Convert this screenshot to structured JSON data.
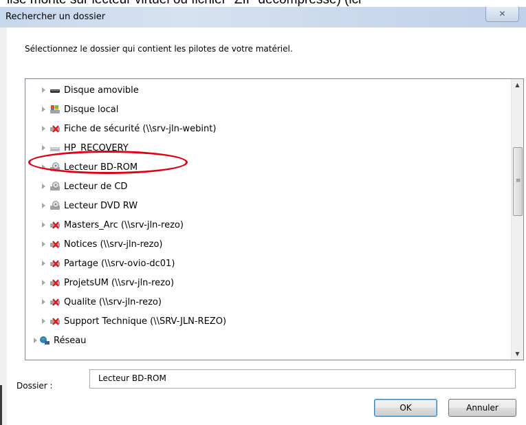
{
  "background_text": "lise monte sur lecteur virtuel ou fichier \"ZIP décompressé) (ici",
  "dialog": {
    "title": "Rechercher un dossier",
    "close_glyph": "✕",
    "instruction": "Sélectionnez le dossier qui contient les pilotes de votre matériel.",
    "tree": {
      "items": [
        {
          "label": "Disque amovible",
          "icon": "removable-drive-icon"
        },
        {
          "label": "Disque local",
          "icon": "local-disk-icon"
        },
        {
          "label": "Fiche de sécurité (\\\\srv-jln-webint)",
          "icon": "disconnected-network-drive-icon"
        },
        {
          "label": "HP_RECOVERY",
          "icon": "hard-drive-icon"
        },
        {
          "label": "Lecteur BD-ROM",
          "icon": "optical-drive-icon"
        },
        {
          "label": "Lecteur de CD",
          "icon": "optical-drive-icon"
        },
        {
          "label": "Lecteur DVD RW",
          "icon": "optical-drive-icon"
        },
        {
          "label": "Masters_Arc (\\\\srv-jln-rezo)",
          "icon": "disconnected-network-drive-icon"
        },
        {
          "label": "Notices (\\\\srv-jln-rezo)",
          "icon": "disconnected-network-drive-icon"
        },
        {
          "label": "Partage (\\\\srv-ovio-dc01)",
          "icon": "disconnected-network-drive-icon"
        },
        {
          "label": "ProjetsUM (\\\\srv-jln-rezo)",
          "icon": "disconnected-network-drive-icon"
        },
        {
          "label": "Qualite (\\\\srv-jln-rezo)",
          "icon": "disconnected-network-drive-icon"
        },
        {
          "label": "Support Technique (\\\\SRV-JLN-REZO)",
          "icon": "disconnected-network-drive-icon"
        },
        {
          "label": "Réseau",
          "icon": "network-icon"
        }
      ],
      "highlighted_item": "Lecteur BD-ROM",
      "highlight_color": "#e3000f"
    },
    "folder_label": "Dossier :",
    "folder_value": "Lecteur BD-ROM",
    "ok_label": "OK",
    "cancel_label": "Annuler"
  }
}
